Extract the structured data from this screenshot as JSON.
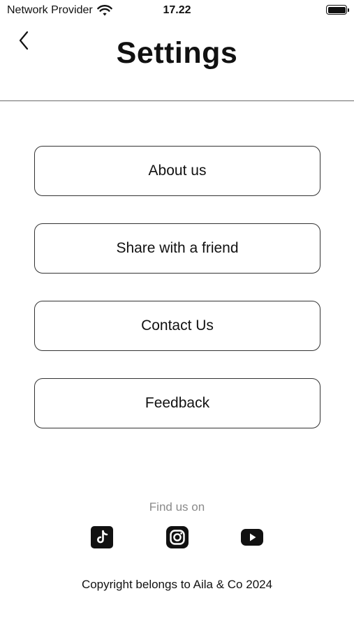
{
  "status_bar": {
    "carrier": "Network Provider",
    "time": "17.22",
    "wifi_icon": "wifi-icon",
    "battery_icon": "battery-icon",
    "battery_level": 1.0
  },
  "header": {
    "title": "Settings",
    "back_icon": "chevron-left-icon"
  },
  "menu": {
    "items": [
      {
        "label": "About us"
      },
      {
        "label": "Share with a friend"
      },
      {
        "label": "Contact Us"
      },
      {
        "label": "Feedback"
      }
    ]
  },
  "footer": {
    "find_us_label": "Find us on",
    "socials": [
      {
        "icon": "tiktok-icon"
      },
      {
        "icon": "instagram-icon"
      },
      {
        "icon": "youtube-icon"
      }
    ],
    "copyright": "Copyright belongs to Aila & Co 2024"
  },
  "colors": {
    "background": "#ffffff",
    "text": "#111111",
    "muted_text": "#8a8a8a",
    "border": "#333333",
    "divider": "#6b6b6b"
  }
}
